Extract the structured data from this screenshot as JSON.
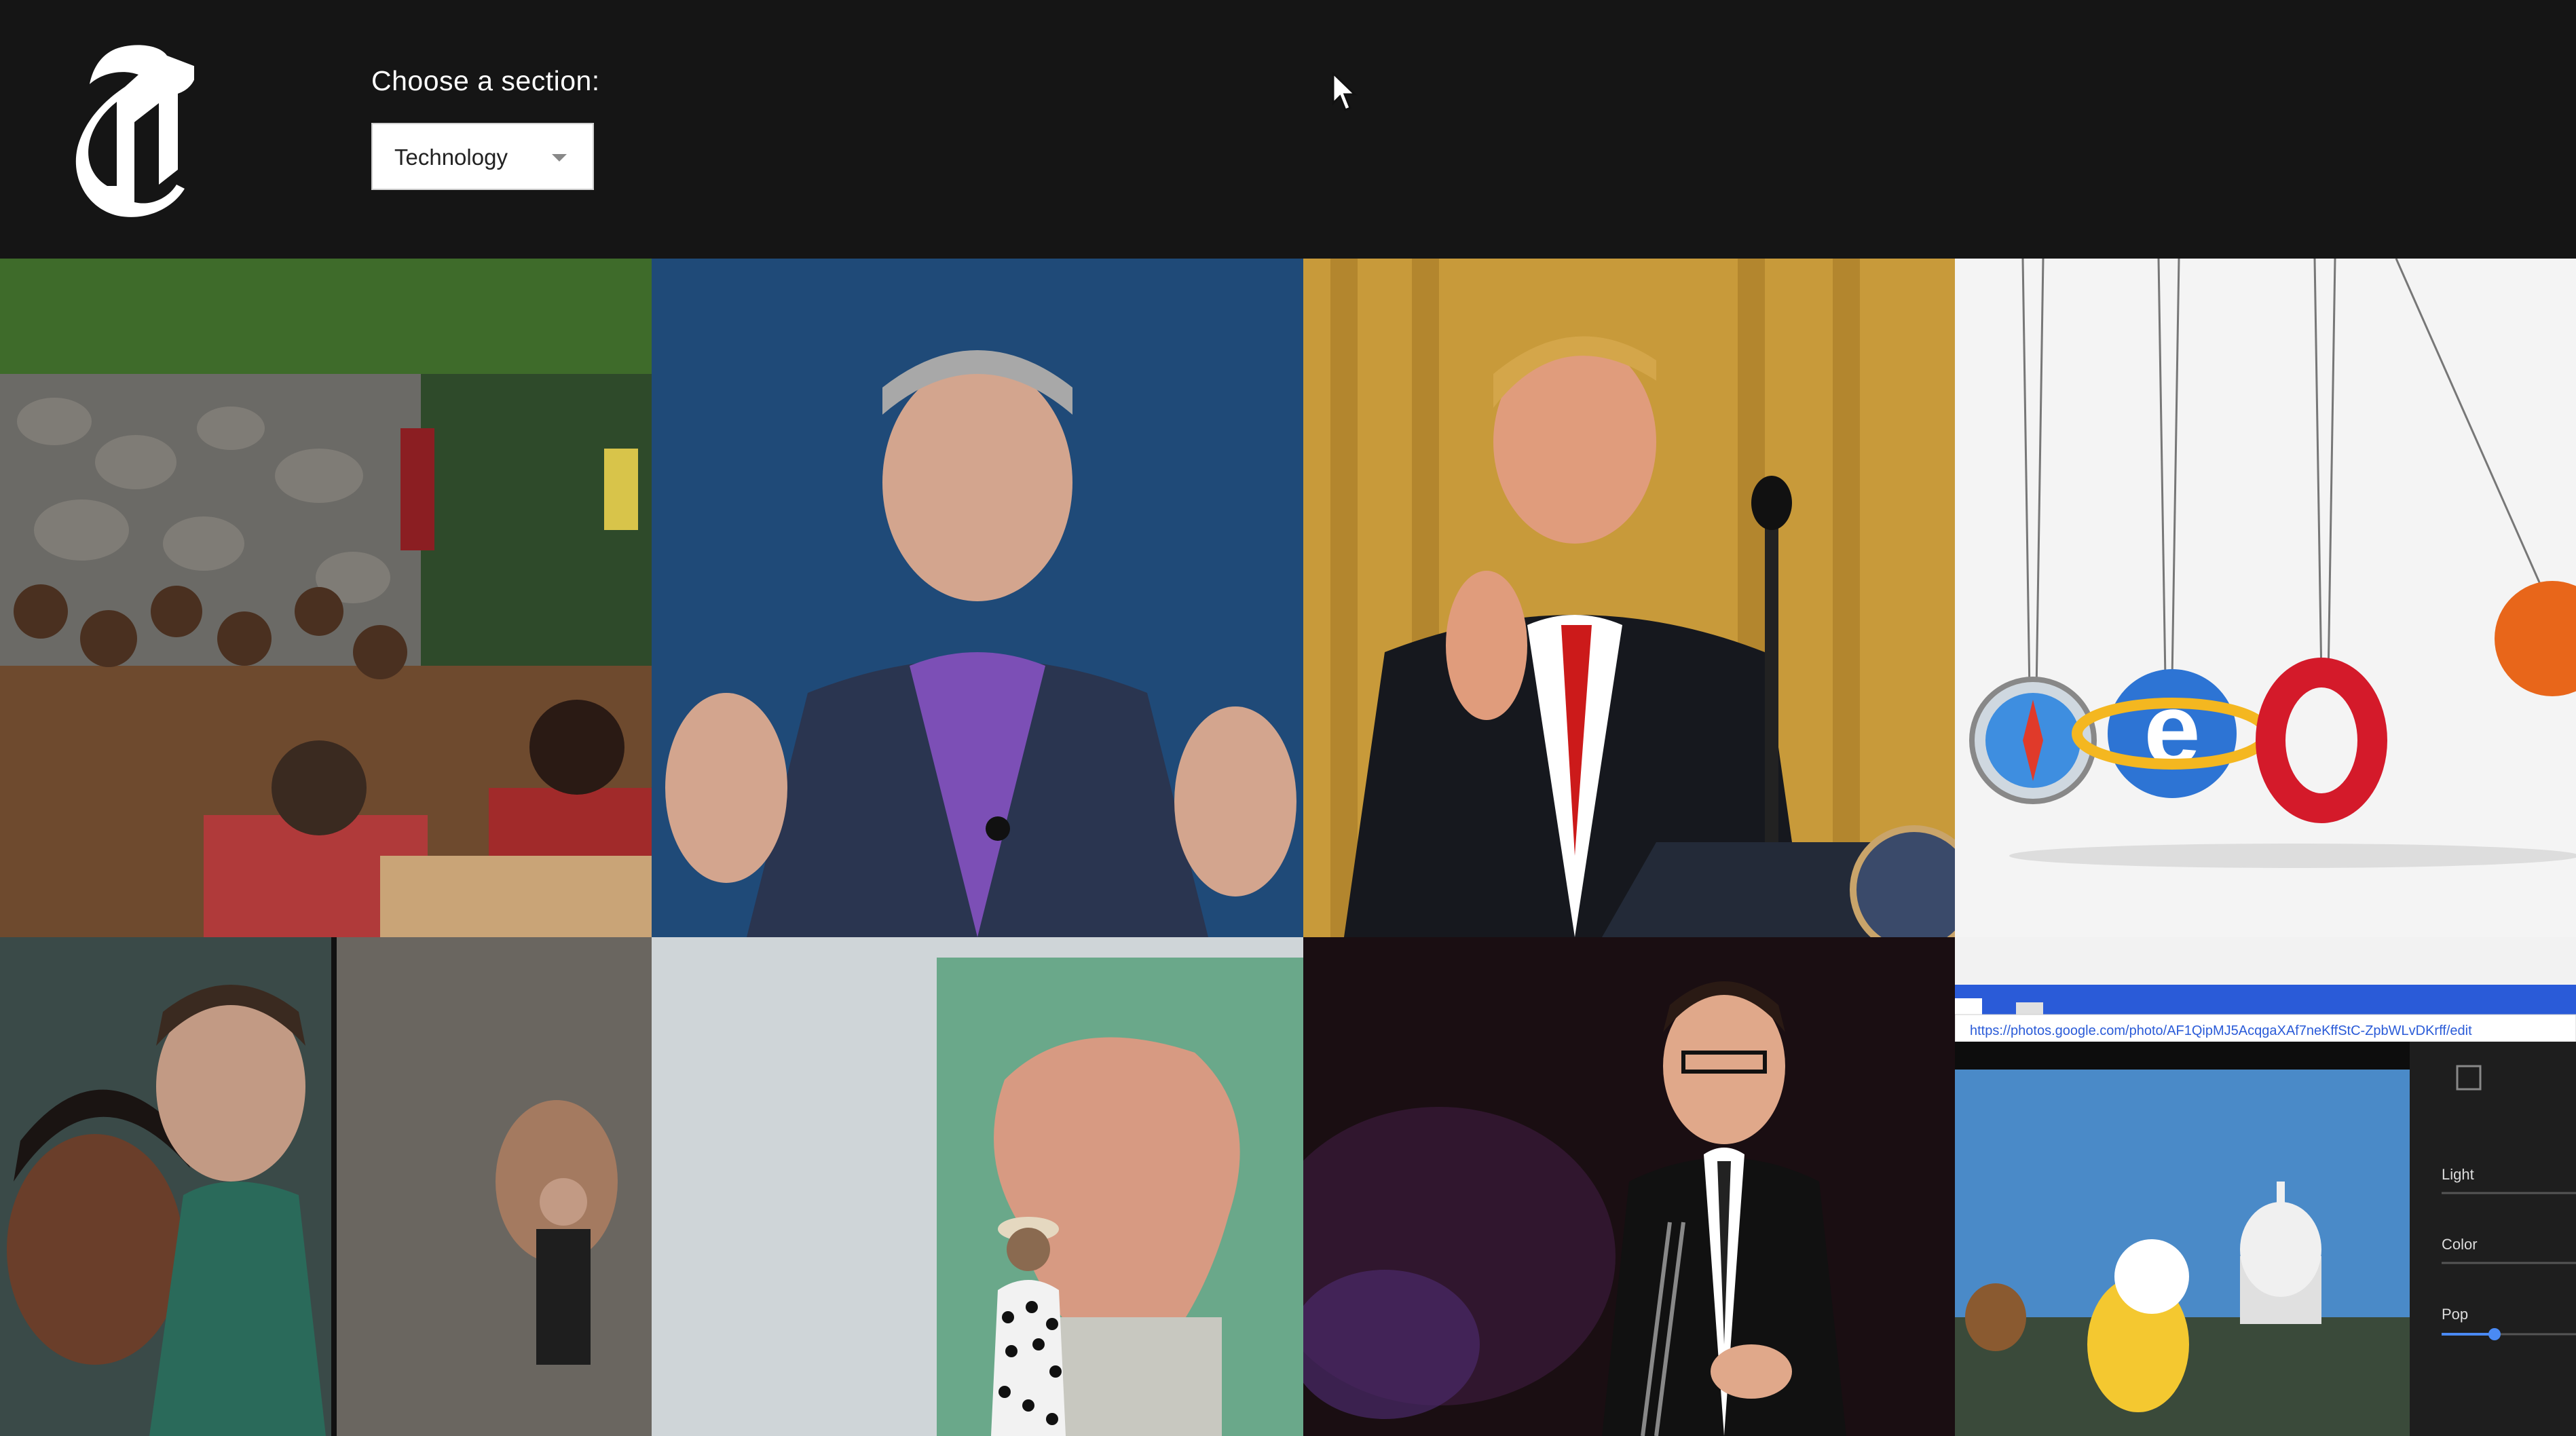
{
  "header": {
    "logo": "nyt-t-logo",
    "section_label": "Choose a section:",
    "section_select": {
      "selected": "Technology"
    }
  },
  "grid": {
    "tiles": [
      {
        "icon": "restaurant-photo"
      },
      {
        "icon": "executive-speaking-photo"
      },
      {
        "icon": "president-podium-photo"
      },
      {
        "icon": "browser-logos-photo"
      },
      {
        "icon": "group-people-photo"
      },
      {
        "icon": "mosaic-wall-photo"
      },
      {
        "icon": "host-on-stage-photo"
      },
      {
        "icon": "photo-editor-screenshot",
        "url": "https://photos.google.com/photo/AF1QipMJ5AcqgaXAf7neKffStC-ZpbWLvDKrff/edit",
        "controls": [
          "Light",
          "Color",
          "Pop"
        ]
      }
    ]
  },
  "colors": {
    "background": "#151515",
    "select_bg": "#ffffff"
  }
}
